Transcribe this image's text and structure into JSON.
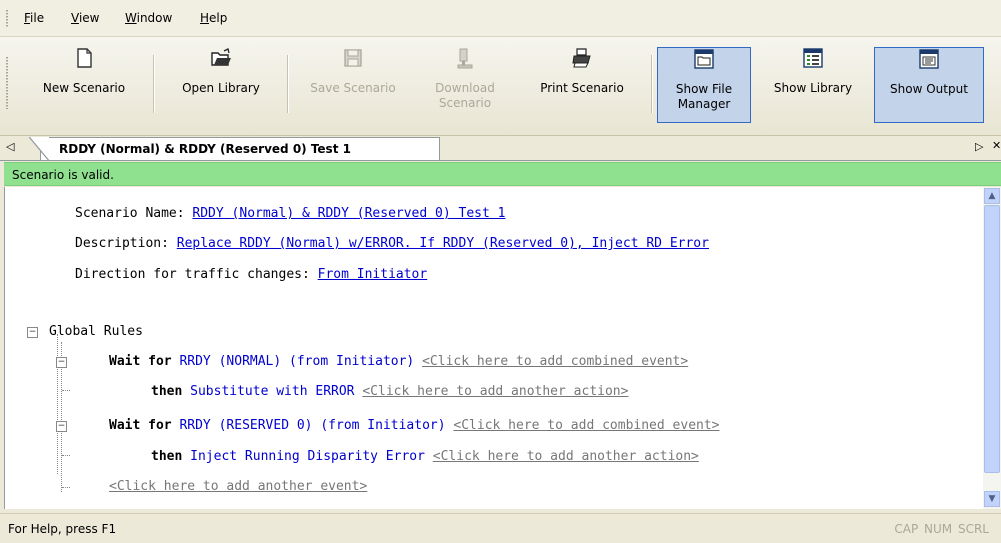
{
  "menu": {
    "file": {
      "hotkey": "F",
      "rest": "ile"
    },
    "view": {
      "hotkey": "V",
      "rest": "iew"
    },
    "window": {
      "hotkey": "W",
      "rest": "indow"
    },
    "help": {
      "hotkey": "H",
      "rest": "elp"
    }
  },
  "toolbar": {
    "new_scenario": "New Scenario",
    "open_library": "Open Library",
    "save_scenario": "Save Scenario",
    "download_scenario_1": "Download",
    "download_scenario_2": "Scenario",
    "print_scenario": "Print Scenario",
    "show_file_manager_1": "Show File",
    "show_file_manager_2": "Manager",
    "show_library": "Show Library",
    "show_output": "Show Output"
  },
  "tab": {
    "title": "RDDY (Normal) & RDDY (Reserved 0) Test 1",
    "scroll_left": "◁",
    "scroll_right": "▷",
    "close": "✕"
  },
  "banner": "Scenario is valid.",
  "scenario": {
    "name_label": "Scenario Name:",
    "name_value": "RDDY (Normal) & RDDY (Reserved 0) Test 1",
    "desc_label": "Description:",
    "desc_value": "Replace RDDY (Normal) w/ERROR. If RDDY (Reserved 0), Inject RD Error",
    "dir_label": "Direction for traffic changes:",
    "dir_value": "From Initiator"
  },
  "rules": {
    "global": "Global Rules",
    "wait_for": "Wait for",
    "then": "then",
    "rule1_event": "RRDY (NORMAL) (from Initiator)",
    "rule1_combined": "<Click here to add combined event>",
    "rule1_action": "Substitute with ERROR",
    "rule1_another": "<Click here to add another action>",
    "rule2_event": "RRDY (RESERVED 0) (from Initiator)",
    "rule2_combined": "<Click here to add combined event>",
    "rule2_action": "Inject Running Disparity Error",
    "rule2_another": "<Click here to add another action>",
    "add_event": "<Click here to add another event>"
  },
  "statusbar": {
    "help": "For Help, press F1",
    "indicators": "CAP NUM SCRL"
  }
}
